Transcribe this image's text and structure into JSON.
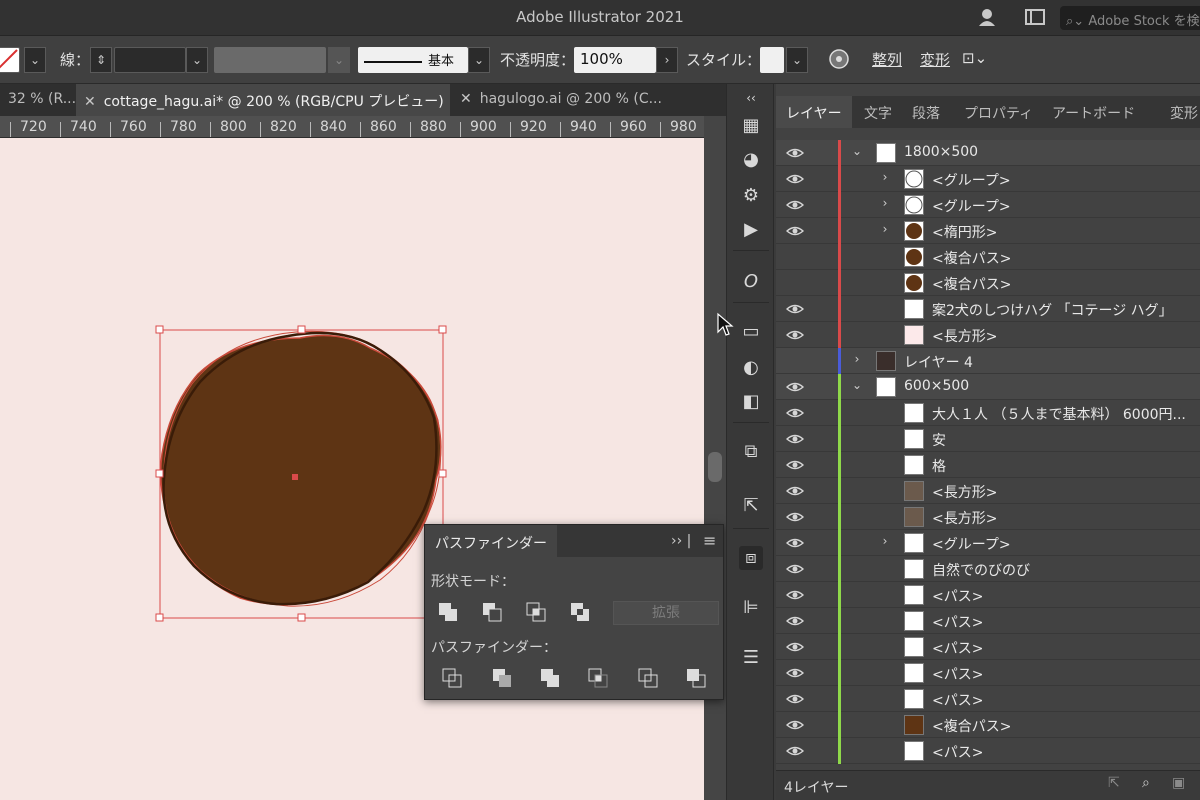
{
  "app": {
    "title": "Adobe Illustrator 2021",
    "stock_search": "Adobe Stock を検"
  },
  "control_bar": {
    "stroke_label": "線：",
    "stroke_profile": "基本",
    "opacity_label": "不透明度：",
    "opacity_value": "100%",
    "style_label": "スタイル：",
    "align_label": "整列",
    "transform_label": "変形"
  },
  "doc_tabs": [
    {
      "label": "32 % (R..."
    },
    {
      "label": "cottage_hagu.ai* @ 200 % (RGB/CPU プレビュー)"
    },
    {
      "label": "hagulogo.ai @ 200 % (C..."
    }
  ],
  "ruler": {
    "ticks": [
      "720",
      "740",
      "760",
      "780",
      "800",
      "820",
      "840",
      "860",
      "880",
      "900",
      "920",
      "940",
      "960",
      "980"
    ]
  },
  "layers_panel": {
    "tabs": [
      "レイヤー",
      "文字",
      "段落",
      "プロパティ",
      "アートボード",
      "変形"
    ],
    "rows": [
      {
        "label": "1800×500",
        "expanded": true,
        "level": 0,
        "color": "#d94a4a"
      },
      {
        "label": "<グループ>",
        "level": 1,
        "color": "#d94a4a"
      },
      {
        "label": "<グループ>",
        "level": 1,
        "color": "#d94a4a"
      },
      {
        "label": "<楕円形>",
        "level": 1,
        "color": "#d94a4a"
      },
      {
        "label": "<複合パス>",
        "level": 1,
        "color": "#d94a4a"
      },
      {
        "label": "<複合パス>",
        "level": 1,
        "color": "#d94a4a"
      },
      {
        "label": "案2犬のしつけハグ 「コテージ ハグ」",
        "level": 1,
        "color": "#d94a4a"
      },
      {
        "label": "<長方形>",
        "level": 1,
        "color": "#d94a4a"
      },
      {
        "label": "レイヤー 4",
        "level": 0,
        "color": "#4a5cd9"
      },
      {
        "label": "600×500",
        "expanded": true,
        "level": 0,
        "color": "#8fd94a"
      },
      {
        "label": "大人１人 （５人まで基本料） 6000円...",
        "level": 1,
        "color": "#8fd94a"
      },
      {
        "label": "安",
        "level": 1,
        "color": "#8fd94a"
      },
      {
        "label": "格",
        "level": 1,
        "color": "#8fd94a"
      },
      {
        "label": "<長方形>",
        "level": 1,
        "color": "#8fd94a"
      },
      {
        "label": "<長方形>",
        "level": 1,
        "color": "#8fd94a"
      },
      {
        "label": "<グループ>",
        "level": 1,
        "color": "#8fd94a"
      },
      {
        "label": "自然でのびのび",
        "level": 1,
        "color": "#8fd94a"
      },
      {
        "label": "<パス>",
        "level": 1,
        "color": "#8fd94a"
      },
      {
        "label": "<パス>",
        "level": 1,
        "color": "#8fd94a"
      },
      {
        "label": "<パス>",
        "level": 1,
        "color": "#8fd94a"
      },
      {
        "label": "<パス>",
        "level": 1,
        "color": "#8fd94a"
      },
      {
        "label": "<パス>",
        "level": 1,
        "color": "#8fd94a"
      },
      {
        "label": "<複合パス>",
        "level": 1,
        "color": "#8fd94a"
      },
      {
        "label": "<パス>",
        "level": 1,
        "color": "#8fd94a"
      }
    ],
    "footer_count": "4レイヤー"
  },
  "pathfinder": {
    "title": "パスファインダー",
    "shape_modes_label": "形状モード：",
    "pathfinders_label": "パスファインダー：",
    "expand_label": "拡張"
  },
  "colors": {
    "canvas_bg": "#f6e6e3",
    "shape_fill": "#5e3414",
    "selection": "#d94a4a"
  }
}
